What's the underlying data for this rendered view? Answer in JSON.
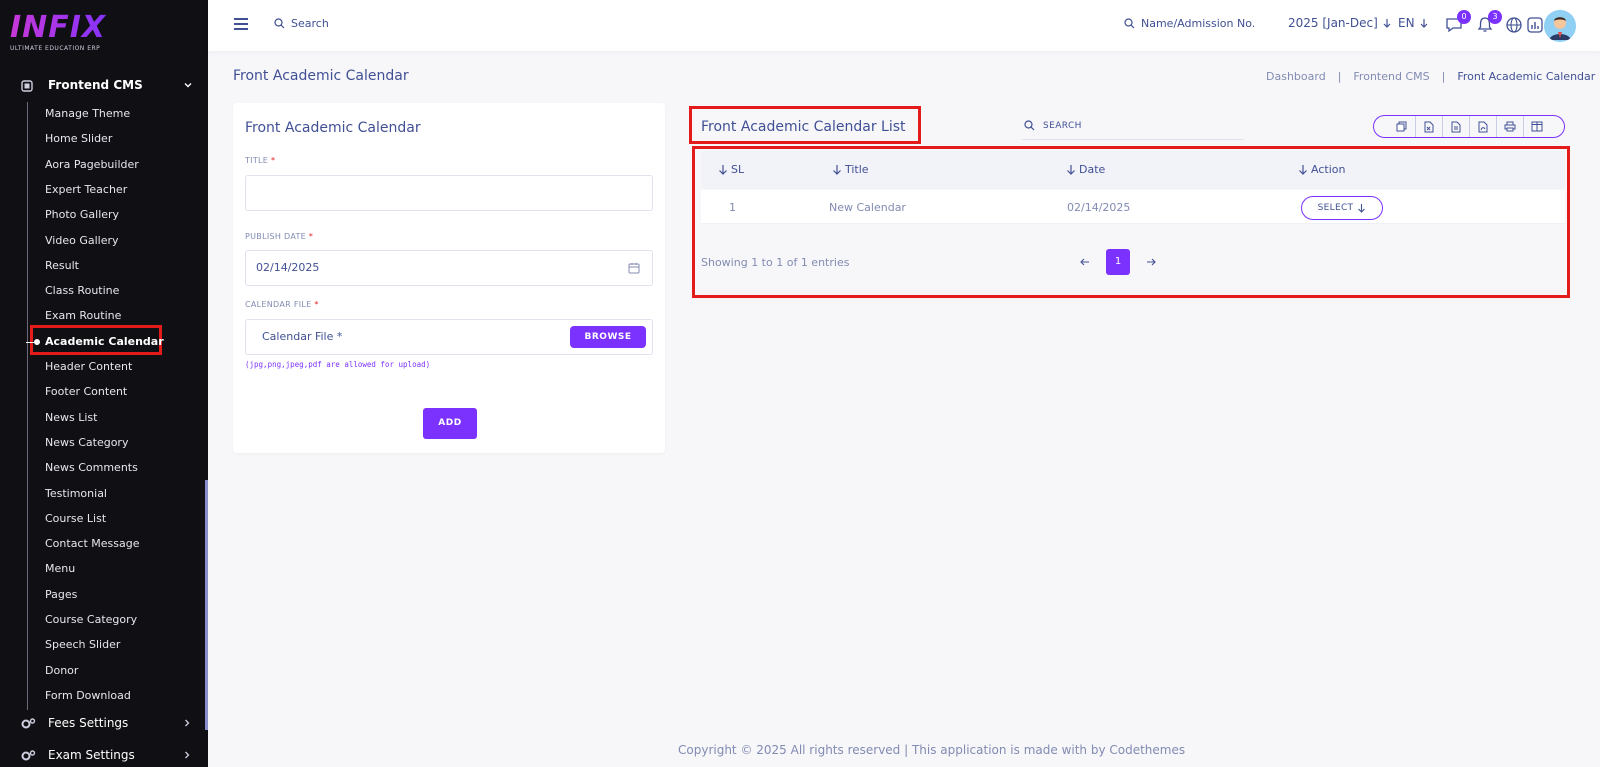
{
  "brand": {
    "name": "INFIX",
    "tagline": "ULTIMATE EDUCATION ERP"
  },
  "sidebar": {
    "section": {
      "label": "Frontend CMS",
      "icon": "cms-icon"
    },
    "items": [
      {
        "label": "Manage Theme"
      },
      {
        "label": "Home Slider"
      },
      {
        "label": "Aora Pagebuilder"
      },
      {
        "label": "Expert Teacher"
      },
      {
        "label": "Photo Gallery"
      },
      {
        "label": "Video Gallery"
      },
      {
        "label": "Result"
      },
      {
        "label": "Class Routine"
      },
      {
        "label": "Exam Routine"
      },
      {
        "label": "Academic Calendar",
        "active": true
      },
      {
        "label": "Header Content"
      },
      {
        "label": "Footer Content"
      },
      {
        "label": "News List"
      },
      {
        "label": "News Category"
      },
      {
        "label": "News Comments"
      },
      {
        "label": "Testimonial"
      },
      {
        "label": "Course List"
      },
      {
        "label": "Contact Message"
      },
      {
        "label": "Menu"
      },
      {
        "label": "Pages"
      },
      {
        "label": "Course Category"
      },
      {
        "label": "Speech Slider"
      },
      {
        "label": "Donor"
      },
      {
        "label": "Form Download"
      }
    ],
    "bottom": [
      {
        "label": "Fees Settings",
        "icon": "gears-icon"
      },
      {
        "label": "Exam Settings",
        "icon": "gears-icon"
      }
    ]
  },
  "topbar": {
    "search_label": "Search",
    "name_search_label": "Name/Admission No.",
    "year": "2025 [Jan-Dec]",
    "language": "EN",
    "chat_badge": "0",
    "notification_badge": "3"
  },
  "page": {
    "title": "Front Academic Calendar",
    "breadcrumb": [
      "Dashboard",
      "Frontend CMS",
      "Front Academic Calendar"
    ],
    "separator": "|"
  },
  "form": {
    "title": "Front Academic Calendar",
    "title_label": "TITLE",
    "title_value": "",
    "publish_date_label": "PUBLISH DATE",
    "publish_date_value": "02/14/2025",
    "file_label": "CALENDAR FILE",
    "file_placeholder": "Calendar File *",
    "browse_label": "BROWSE",
    "hint": "(jpg,png,jpeg,pdf are allowed for upload)",
    "required_mark": "*",
    "add_label": "ADD"
  },
  "list": {
    "title": "Front Academic Calendar List",
    "search_placeholder": "SEARCH",
    "export_icons": [
      "copy-icon",
      "excel-icon",
      "csv-icon",
      "pdf-icon",
      "print-icon",
      "columns-icon"
    ],
    "columns": [
      "SL",
      "Title",
      "Date",
      "Action"
    ],
    "rows": [
      {
        "sl": "1",
        "title": "New Calendar",
        "date": "02/14/2025",
        "action": "SELECT"
      }
    ],
    "entries_text": "Showing 1 to 1 of 1 entries",
    "current_page": "1"
  },
  "footer": {
    "text": "Copyright © 2025 All rights reserved | This application is made with by Codethemes"
  },
  "colors": {
    "accent": "#7c32ff",
    "sidebar_bg": "#0f0f14",
    "text": "#415094",
    "muted": "#828bb2",
    "highlight": "#e41b1b"
  }
}
